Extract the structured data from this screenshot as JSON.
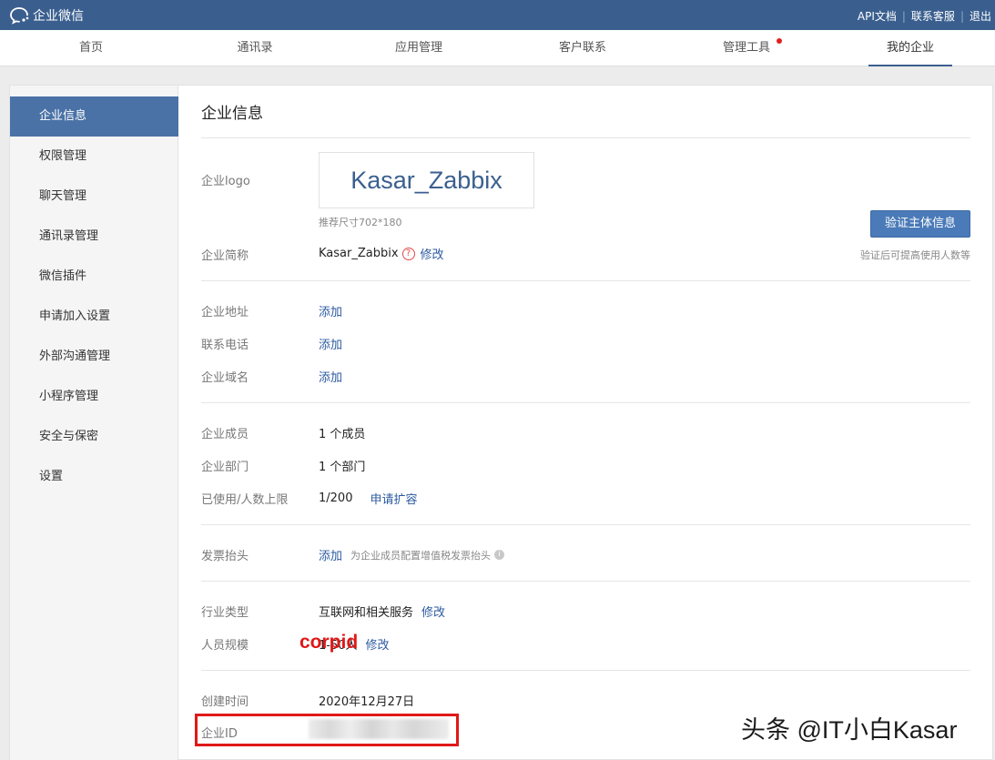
{
  "app": {
    "title": "企业微信"
  },
  "top_links": {
    "api_docs": "API文档",
    "support": "联系客服",
    "logout": "退出"
  },
  "nav": {
    "items": [
      {
        "label": "首页"
      },
      {
        "label": "通讯录"
      },
      {
        "label": "应用管理"
      },
      {
        "label": "客户联系"
      },
      {
        "label": "管理工具"
      },
      {
        "label": "我的企业"
      }
    ],
    "active": "我的企业"
  },
  "sidebar": {
    "items": [
      {
        "label": "企业信息"
      },
      {
        "label": "权限管理"
      },
      {
        "label": "聊天管理"
      },
      {
        "label": "通讯录管理"
      },
      {
        "label": "微信插件"
      },
      {
        "label": "申请加入设置"
      },
      {
        "label": "外部沟通管理"
      },
      {
        "label": "小程序管理"
      },
      {
        "label": "安全与保密"
      },
      {
        "label": "设置"
      }
    ],
    "active": "企业信息"
  },
  "main": {
    "title": "企业信息",
    "logo": {
      "label": "企业logo",
      "image_text": "Kasar_Zabbix",
      "hint": "推荐尺寸702*180"
    },
    "verify": {
      "button": "验证主体信息",
      "hint": "验证后可提高使用人数等"
    },
    "short_name": {
      "label": "企业简称",
      "value": "Kasar_Zabbix",
      "help": "?",
      "edit": "修改"
    },
    "address": {
      "label": "企业地址",
      "action": "添加"
    },
    "phone": {
      "label": "联系电话",
      "action": "添加"
    },
    "domain": {
      "label": "企业域名",
      "action": "添加"
    },
    "members": {
      "label": "企业成员",
      "value": "1 个成员"
    },
    "departments": {
      "label": "企业部门",
      "value": "1 个部门"
    },
    "usage": {
      "label": "已使用/人数上限",
      "value": "1/200",
      "action": "申请扩容"
    },
    "invoice": {
      "label": "发票抬头",
      "action": "添加",
      "hint": "为企业成员配置增值税发票抬头",
      "info": "i"
    },
    "industry": {
      "label": "行业类型",
      "value": "互联网和相关服务",
      "edit": "修改"
    },
    "scale": {
      "label": "人员规模",
      "value": "1-50人",
      "edit": "修改"
    },
    "created": {
      "label": "创建时间",
      "value": "2020年12月27日"
    },
    "corp_id": {
      "label": "企业ID"
    }
  },
  "annotation": {
    "text": "corpid",
    "color": "#e01818"
  },
  "watermark": {
    "text": "头条 @IT小白Kasar"
  },
  "colors": {
    "header": "#3a5f8f",
    "accent": "#4a72a6",
    "link": "#2b5aa0"
  }
}
